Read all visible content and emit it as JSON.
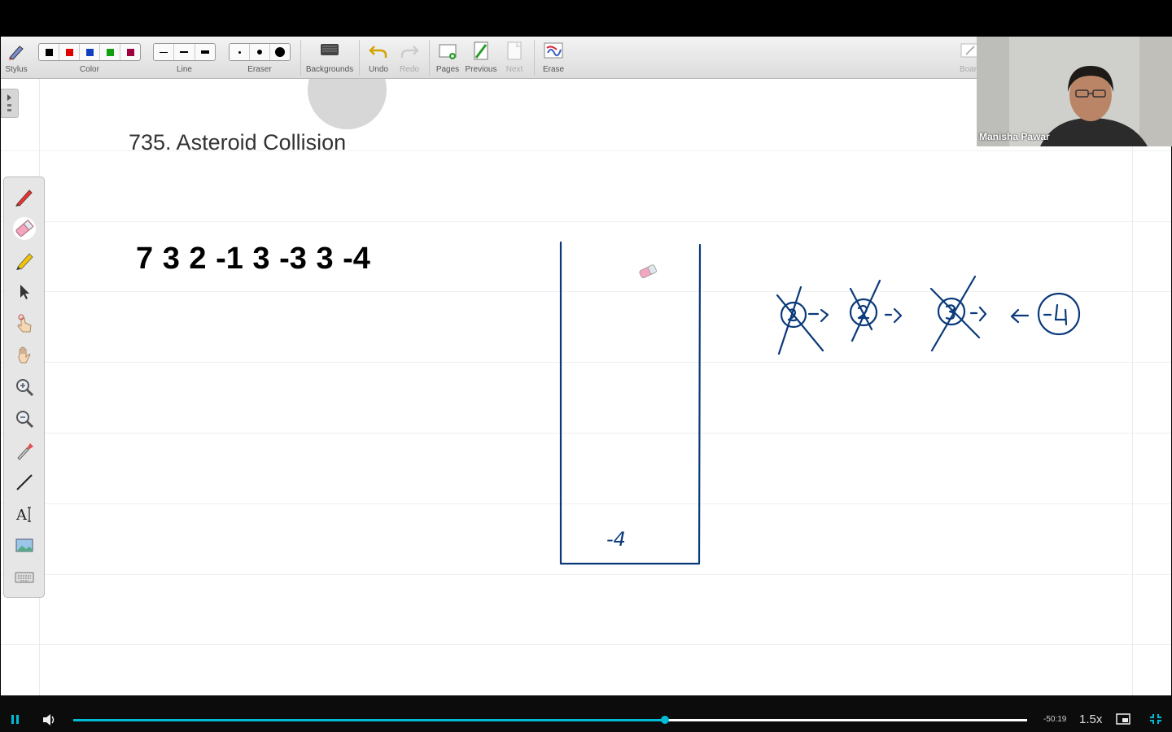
{
  "toolbar": {
    "stylus": "Stylus",
    "color": "Color",
    "line": "Line",
    "eraser": "Eraser",
    "backgrounds": "Backgrounds",
    "undo": "Undo",
    "redo": "Redo",
    "pages": "Pages",
    "previous": "Previous",
    "next": "Next",
    "erase": "Erase",
    "board": "Boar",
    "colors": [
      "#000000",
      "#e00000",
      "#1040c0",
      "#10a010",
      "#a00040"
    ]
  },
  "page": {
    "title": "735. Asteroid Collision",
    "array": "7 3 2 -1 3 -3 3 -4",
    "stack_item": "-4",
    "ink_color": "#0a3a7a"
  },
  "webcam": {
    "name": "Manisha Pawar"
  },
  "player": {
    "progress": 0.62,
    "time_remaining": "-50:19",
    "speed": "1.5x",
    "accent": "#00bcd4"
  },
  "palette": {
    "items": [
      "pen-icon",
      "eraser-icon",
      "highlighter-icon",
      "select-arrow-icon",
      "touch-icon",
      "hand-icon",
      "zoom-in-icon",
      "zoom-out-icon",
      "eyedropper-icon",
      "line-tool-icon",
      "text-tool-icon",
      "image-icon",
      "keyboard-icon"
    ]
  }
}
